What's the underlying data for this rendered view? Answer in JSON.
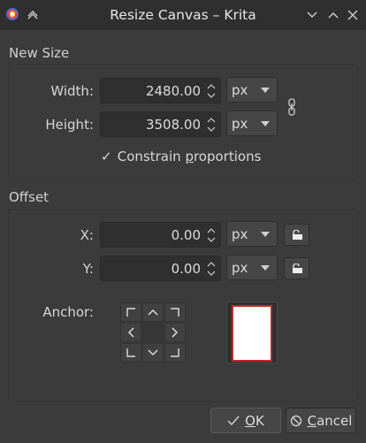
{
  "window": {
    "title": "Resize Canvas – Krita"
  },
  "new_size": {
    "section_label": "New Size",
    "width_label": "Width:",
    "width_value": "2480.00",
    "width_unit": "px",
    "height_label": "Height:",
    "height_value": "3508.00",
    "height_unit": "px",
    "constrain_checked": true,
    "constrain_label_pre": "Constrain ",
    "constrain_label_u": "p",
    "constrain_label_post": "roportions"
  },
  "offset": {
    "section_label": "Offset",
    "x_label": "X:",
    "x_value": "0.00",
    "x_unit": "px",
    "y_label": "Y:",
    "y_value": "0.00",
    "y_unit": "px",
    "anchor_label": "Anchor:"
  },
  "buttons": {
    "ok_u": "O",
    "ok_rest": "K",
    "cancel_u": "C",
    "cancel_rest": "ancel"
  },
  "colors": {
    "preview_border": "#c0292b",
    "background": "#3b3b3b"
  }
}
